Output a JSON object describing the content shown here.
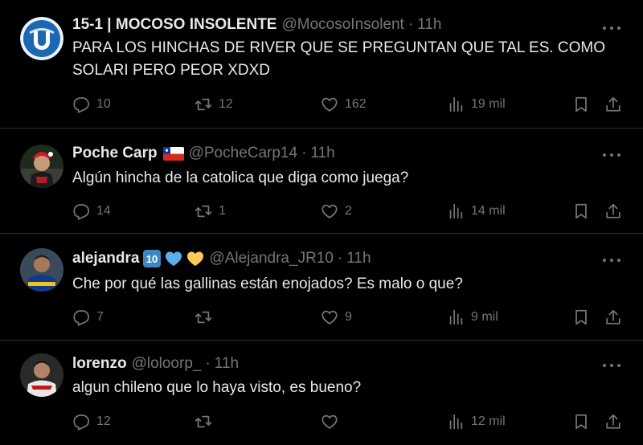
{
  "tweets": [
    {
      "name": "15-1 | MOCOSO INSOLENTE",
      "handle": "@MocosoInsolent",
      "separator": "·",
      "time": "11h",
      "text": "PARA LOS HINCHAS DE RIVER QUE SE PREGUNTAN QUE TAL ES. COMO SOLARI PERO PEOR XDXD",
      "replies": "10",
      "retweets": "12",
      "likes": "162",
      "views": "19 mil",
      "avatar_icon": "u-shield-logo"
    },
    {
      "name": "Poche Carp",
      "handle": "@PocheCarp14",
      "separator": "·",
      "time": "11h",
      "text": "Algún hincha de la catolica que diga como juega?",
      "replies": "14",
      "retweets": "1",
      "likes": "2",
      "views": "14 mil",
      "name_emoji": "chile-flag"
    },
    {
      "name": "alejandra",
      "handle": "@Alejandra_JR10",
      "separator": "·",
      "time": "11h",
      "text": "Che por qué las gallinas están enojados? Es malo o que?",
      "replies": "7",
      "retweets": "",
      "likes": "9",
      "views": "9 mil",
      "name_emoji": "keycap-10 blue-heart yellow-heart"
    },
    {
      "name": "lorenzo",
      "handle": "@loloorp_",
      "separator": "·",
      "time": "11h",
      "text": "algun chileno que lo haya visto, es bueno?",
      "replies": "12",
      "retweets": "",
      "likes": "",
      "views": "12 mil"
    }
  ],
  "colors": {
    "background": "#000000",
    "text": "#e7e9ea",
    "secondary": "#71767b",
    "divider": "#2f3336"
  }
}
